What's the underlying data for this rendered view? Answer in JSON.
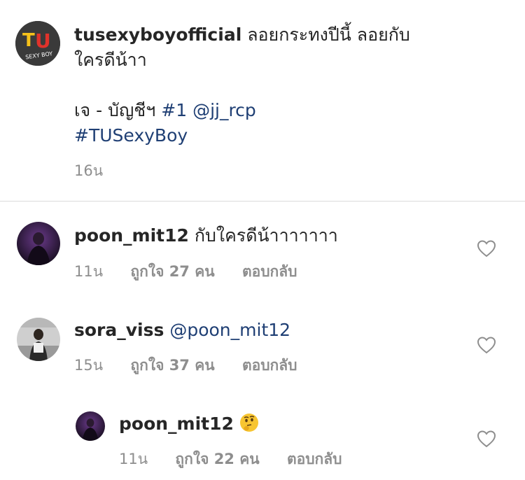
{
  "caption": {
    "avatar_text": "TU",
    "avatar_subtext": "SEXY BOY",
    "username": "tusexyboyofficial",
    "text_line1": "ลอยกระทงปีนี้ ลอยกับ",
    "text_line2": "ใครดีน้าา",
    "text_line3_plain": "เจ - บัญชีฯ",
    "text_line3_tag": "#1",
    "text_line3_mention": "@jj_rcp",
    "text_line4_tag": "#TUSexyBoy",
    "time": "16น"
  },
  "comments": [
    {
      "username": "poon_mit12",
      "text": "กับใครดีน้าาาาาาา",
      "mention": "",
      "time": "11น",
      "likes": "ถูกใจ 27 คน",
      "reply": "ตอบกลับ"
    },
    {
      "username": "sora_viss",
      "text": "",
      "mention": "@poon_mit12",
      "time": "15น",
      "likes": "ถูกใจ 37 คน",
      "reply": "ตอบกลับ"
    }
  ],
  "reply_comment": {
    "username": "poon_mit12",
    "emoji": "thinking-face",
    "time": "11น",
    "likes": "ถูกใจ 22 คน",
    "reply": "ตอบกลับ"
  },
  "colors": {
    "link": "#1f3f74",
    "meta": "#8e8e8e",
    "divider": "#dbdbdb",
    "logo_red": "#e0322b",
    "logo_yellow": "#f6c21a"
  },
  "icons": [
    "tu-sexy-boy-logo",
    "heart-outline-icon",
    "thinking-face-emoji"
  ]
}
